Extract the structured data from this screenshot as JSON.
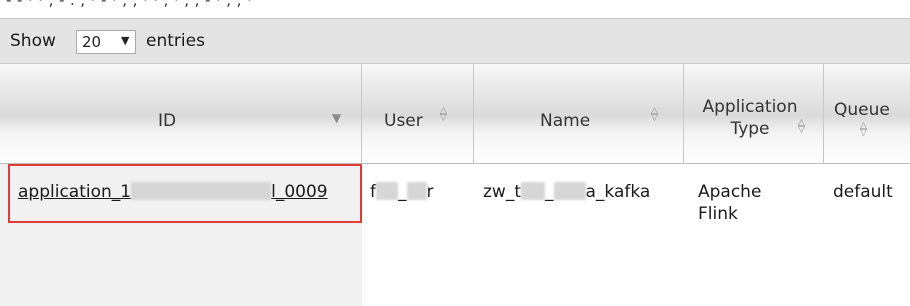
{
  "page": {
    "top_strip_text": "- -  · ·   ,  -  .  ,  · -  ·  ,  ,  ·   ·  ,   · ,  ,  - ·  ,  ,   ·"
  },
  "toolbar": {
    "show_label": "Show",
    "page_size": "20",
    "entries_label": "entries"
  },
  "table": {
    "columns": [
      {
        "label": "ID",
        "sort_icon": "sort-desc-icon"
      },
      {
        "label": "User",
        "sort_icon": "sort-both-icon"
      },
      {
        "label": "Name",
        "sort_icon": "sort-both-icon"
      },
      {
        "label": "Application\nType",
        "sort_icon": "sort-both-icon"
      },
      {
        "label": "Queue",
        "sort_icon": "sort-both-icon"
      }
    ],
    "rows": [
      {
        "id_prefix": "application_1",
        "id_suffix": "l_0009",
        "user_prefix": "f",
        "user_mid": "_",
        "user_suffix": "r",
        "name_prefix": "zw_t",
        "name_mid": "_",
        "name_suffix": "a_kafka",
        "type": "Apache\nFlink",
        "queue": "default"
      }
    ]
  },
  "colors": {
    "highlight": "#e03a3a",
    "selected_row": "#f1f1f1",
    "toolbar_bg": "#e4e4e4"
  }
}
